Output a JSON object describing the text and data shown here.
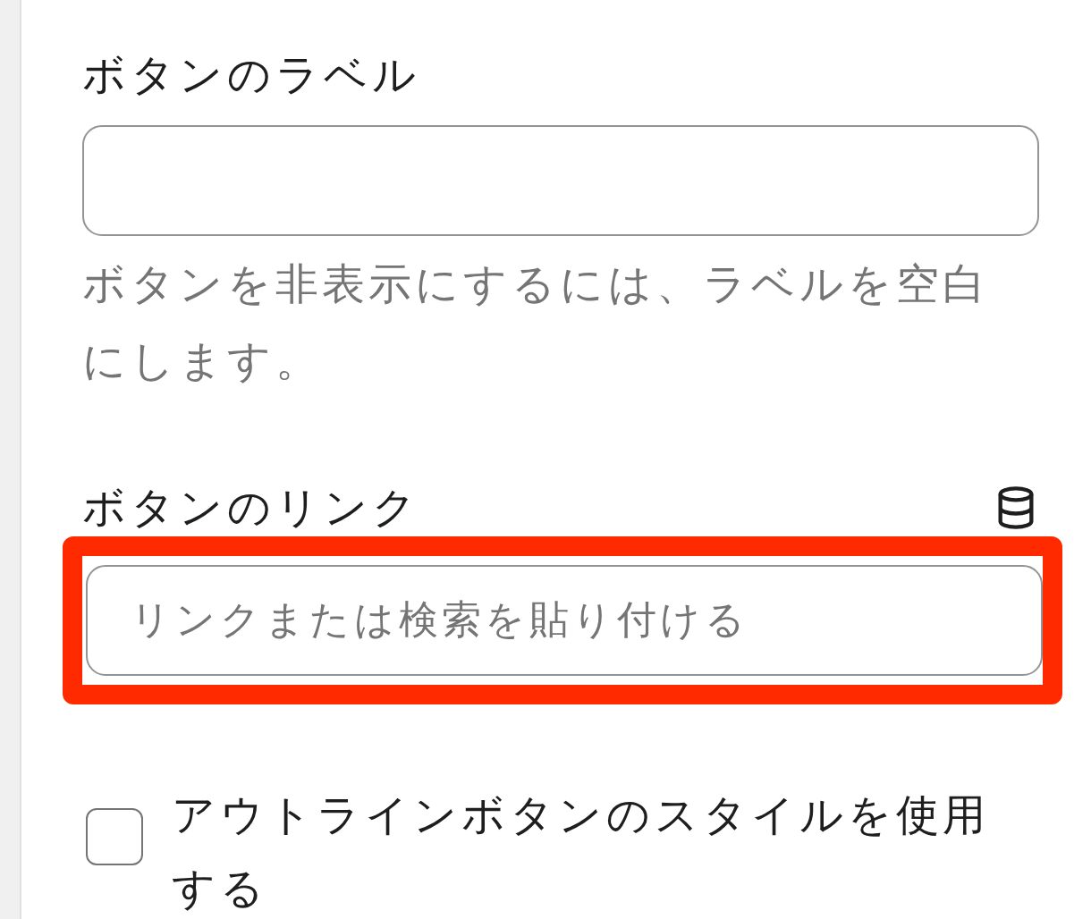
{
  "fields": [
    {
      "label": "ボタンのラベル",
      "help": "ボタンを非表示にするには、ラベルを空白にします。",
      "highlighted": false,
      "source_icon": false
    },
    {
      "label": "ボタンのリンク",
      "placeholder": "リンクまたは検索を貼り付ける",
      "highlighted": true,
      "source_icon": true
    }
  ],
  "checkbox": {
    "label": "アウトラインボタンのスタイルを使用する",
    "checked": false
  }
}
